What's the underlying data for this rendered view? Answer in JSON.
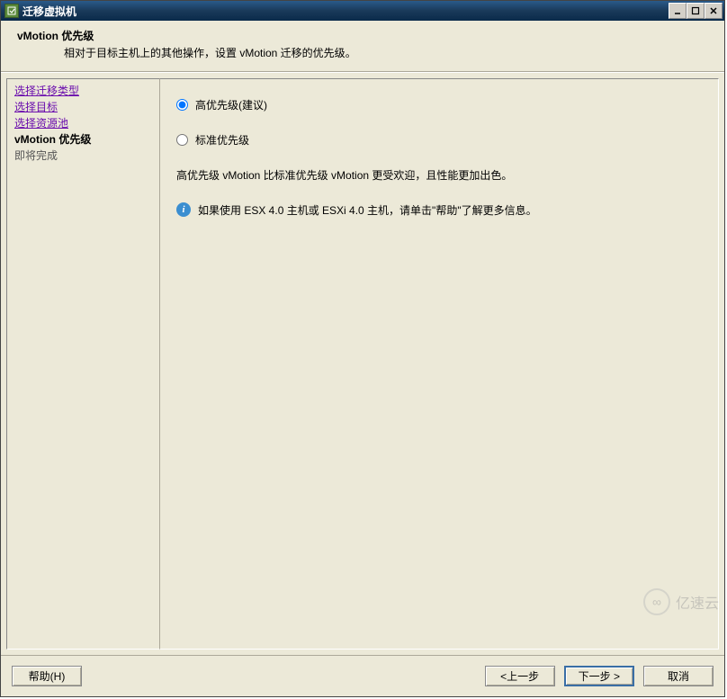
{
  "window": {
    "title": "迁移虚拟机"
  },
  "header": {
    "title": "vMotion 优先级",
    "subtitle": "相对于目标主机上的其他操作，设置 vMotion 迁移的优先级。"
  },
  "sidebar": {
    "items": [
      {
        "label": "选择迁移类型",
        "state": "link"
      },
      {
        "label": "选择目标",
        "state": "link"
      },
      {
        "label": "选择资源池",
        "state": "link"
      },
      {
        "label": "vMotion 优先级",
        "state": "current"
      },
      {
        "label": "即将完成",
        "state": "pending"
      }
    ]
  },
  "content": {
    "options": {
      "high": "高优先级(建议)",
      "standard": "标准优先级"
    },
    "description": "高优先级 vMotion 比标准优先级 vMotion 更受欢迎，且性能更加出色。",
    "info": "如果使用 ESX 4.0 主机或 ESXi 4.0 主机，请单击\"帮助\"了解更多信息。"
  },
  "footer": {
    "help": "帮助(H)",
    "back": "<上一步",
    "next": "下一步 >",
    "cancel": "取消"
  },
  "watermark": "亿速云"
}
